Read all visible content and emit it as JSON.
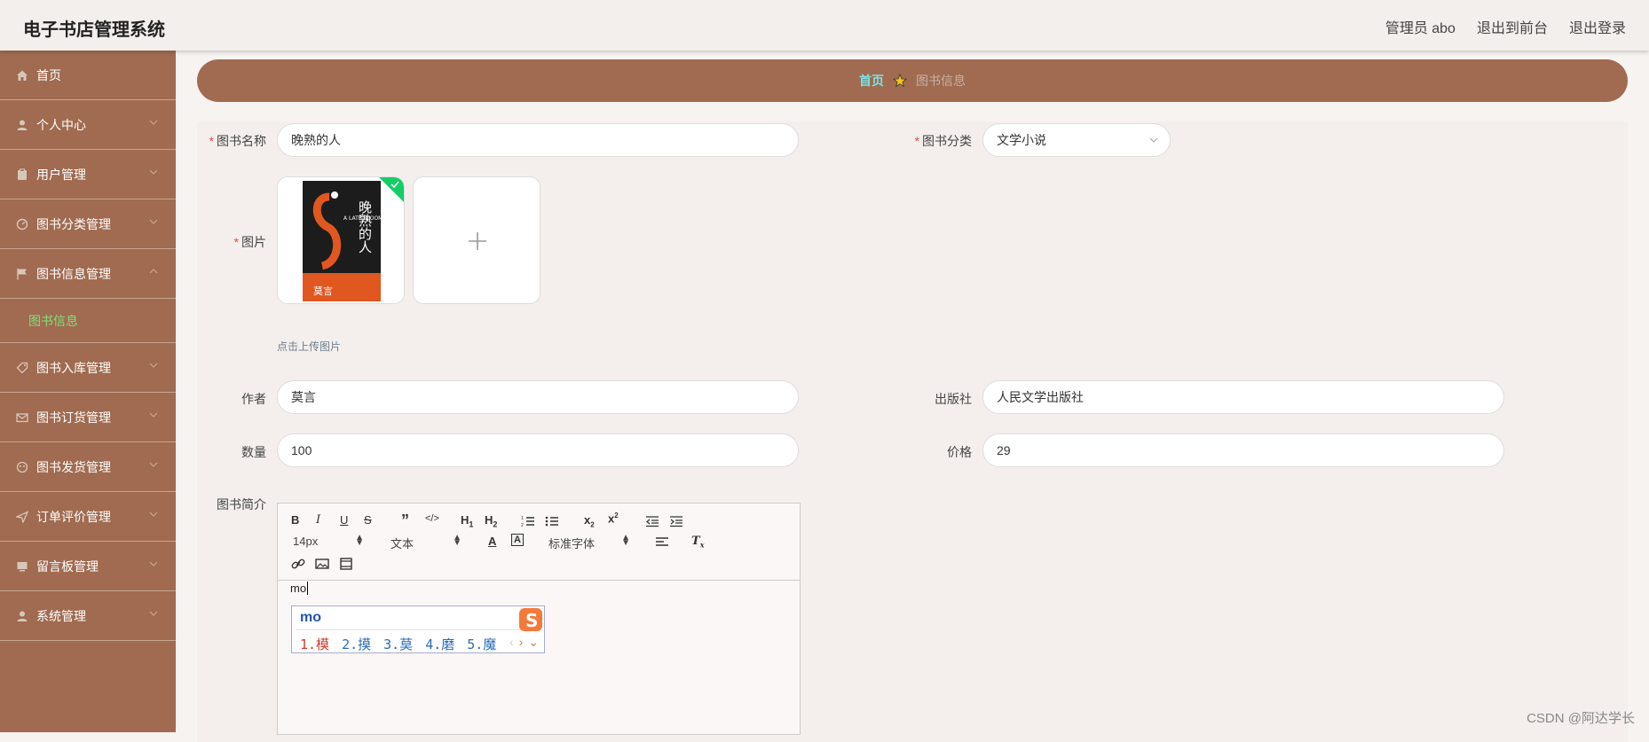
{
  "header": {
    "app_title": "电子书店管理系统",
    "links": [
      "管理员 abo",
      "退出到前台",
      "退出登录"
    ]
  },
  "sidebar": {
    "items": [
      {
        "label": "首页",
        "icon": "home-icon"
      },
      {
        "label": "个人中心",
        "icon": "user-icon"
      },
      {
        "label": "用户管理",
        "icon": "clipboard-icon"
      },
      {
        "label": "图书分类管理",
        "icon": "gauge-icon"
      },
      {
        "label": "图书信息管理",
        "icon": "flag-icon",
        "expanded": true,
        "submenu": [
          "图书信息"
        ]
      },
      {
        "label": "图书入库管理",
        "icon": "tag-icon"
      },
      {
        "label": "图书订货管理",
        "icon": "mail-icon"
      },
      {
        "label": "图书发货管理",
        "icon": "globe-icon"
      },
      {
        "label": "订单评价管理",
        "icon": "send-icon"
      },
      {
        "label": "留言板管理",
        "icon": "monitor-icon"
      },
      {
        "label": "系统管理",
        "icon": "user-icon"
      }
    ],
    "active_color": "#7fe07a"
  },
  "breadcrumb": {
    "home": "首页",
    "current": "图书信息"
  },
  "form": {
    "book_name_label": "图书名称",
    "book_name_value": "晚熟的人",
    "category_label": "图书分类",
    "category_value": "文学小说",
    "image_label": "图片",
    "upload_hint": "点击上传图片",
    "cover_title": "晚熟的人",
    "cover_en": "A LATE BLOOMER",
    "cover_author": "莫言",
    "author_label": "作者",
    "author_value": "莫言",
    "publisher_label": "出版社",
    "publisher_value": "人民文学出版社",
    "quantity_label": "数量",
    "quantity_value": "100",
    "price_label": "价格",
    "price_value": "29",
    "intro_label": "图书简介"
  },
  "editor": {
    "font_size": "14px",
    "block_type": "文本",
    "font_family": "标准字体",
    "content": "mo"
  },
  "ime": {
    "input": "mo",
    "candidates": [
      "1.模",
      "2.摸",
      "3.莫",
      "4.磨",
      "5.魔"
    ]
  },
  "watermark": "CSDN @阿达学长",
  "colors": {
    "sidebar": "#a06b50",
    "breadcrumb_home": "#7de0e6",
    "required": "#e14b4b"
  }
}
